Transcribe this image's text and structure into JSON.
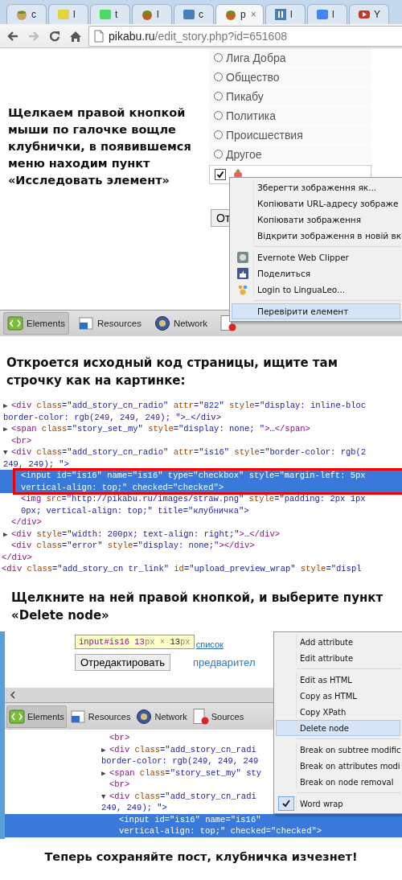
{
  "browser": {
    "tabs": [
      {
        "label": "c",
        "selected": false
      },
      {
        "label": "l",
        "selected": false
      },
      {
        "label": "t",
        "selected": false
      },
      {
        "label": "l",
        "selected": false
      },
      {
        "label": "c",
        "selected": false
      },
      {
        "label": "p",
        "selected": true,
        "close": "×"
      },
      {
        "label": "l",
        "selected": false
      },
      {
        "label": "l",
        "selected": false
      },
      {
        "label": "Y",
        "selected": false
      }
    ],
    "nav": [
      {
        "kind": "back",
        "disabled": false
      },
      {
        "kind": "forward",
        "disabled": true
      },
      {
        "kind": "reload",
        "disabled": false
      },
      {
        "kind": "home",
        "disabled": false
      }
    ],
    "url": {
      "host": "pikabu.ru",
      "path": "/edit_story.php?id=651608"
    }
  },
  "step1": {
    "caption": "Щелкаем правой кнопкой мыши по галочке вощле клубнички, в появившемся меню находим пункт «Исследовать элемент»",
    "radios": [
      {
        "label": "Лига Добра",
        "selected": false
      },
      {
        "label": "Общество",
        "selected": false
      },
      {
        "label": "Пикабу",
        "selected": false
      },
      {
        "label": "Политика",
        "selected": false
      },
      {
        "label": "Происшествия",
        "selected": false
      },
      {
        "label": "Другое",
        "selected": false
      }
    ],
    "checkbox": {
      "checked": true
    },
    "button": "От",
    "menu": [
      {
        "kind": "item",
        "label": "Зберегти зображення як...",
        "selected": false
      },
      {
        "kind": "item",
        "label": "Копіювати URL-адресу зображе",
        "selected": false
      },
      {
        "kind": "item",
        "label": "Копіювати зображення",
        "selected": false
      },
      {
        "kind": "item",
        "label": "Відкрити зображення в новій вк",
        "selected": false
      },
      {
        "kind": "separator"
      },
      {
        "kind": "plugin",
        "label": "Evernote Web Clipper",
        "selected": false
      },
      {
        "kind": "plugin",
        "label": "Поделиться",
        "selected": false
      },
      {
        "kind": "plugin",
        "label": "Login to LinguaLeo...",
        "selected": false
      },
      {
        "kind": "separator"
      },
      {
        "kind": "item",
        "label": "Перевірити елемент",
        "selected": true
      }
    ],
    "devtools_tabs": [
      {
        "label": "Elements",
        "selected": true
      },
      {
        "label": "Resources",
        "selected": false
      },
      {
        "label": "Network",
        "selected": false
      },
      {
        "selected": false
      }
    ]
  },
  "step2": {
    "caption": "Откроется исходный код страницы, ищите там строчку как на картинке:",
    "code": [
      {
        "children": [
          {
            "toggle": "▶",
            "lines": [
              "<div class=\"add_story_cn_radio\" attr=\"822\" style=\"display: inline-bloc",
              "border-color: rgb(249, 249, 249); \">…</div>"
            ],
            "selected": false
          },
          {
            "toggle": "▶",
            "lines": [
              "<span class=\"story_set_my\" style=\"display: none; \">…</span>"
            ],
            "selected": false
          },
          {
            "lines": [
              "<br>"
            ],
            "selected": false
          },
          {
            "toggle": "▼",
            "lines": [
              "<div class=\"add_story_cn_radio\" attr=\"is16\" style=\"border-color: rgb(2",
              "249, 249); \">"
            ],
            "selected": false,
            "closing": "</div>",
            "children": [
              {
                "lines": [
                  "<input id=\"is16\" name=\"is16\" type=\"checkbox\" style=\"margin-left: 5px",
                  "vertical-align: top;\" checked=\"checked\">"
                ],
                "selected": true
              },
              {
                "lines": [
                  "<img src=\"http://pikabu.ru/images/straw.png\" style=\"padding: 2px 1px",
                  "0px; vertical-align: top;\" title=\"клубничка\">"
                ],
                "selected": false
              }
            ]
          },
          {
            "toggle": "▶",
            "lines": [
              "<div style=\"width: 200px; text-align: right;\">…</div>"
            ],
            "selected": false
          },
          {
            "lines": [
              "<div class=\"error\" style=\"display: none;\"></div>"
            ],
            "selected": false
          }
        ],
        "closing": "</div>"
      },
      {
        "lines": [
          "<div class=\"add_story_cn tr_link\" id=\"upload_preview_wrap\" style=\"displ"
        ],
        "selected": false
      }
    ]
  },
  "step3": {
    "caption": "Щелкните на ней правой кнопкой, и выберите пункт «Delete node»",
    "tooltip": "input#is16 13px × 13px",
    "link": "список",
    "button": "Отредактировать",
    "preview_link": "предварител",
    "devtools_tabs": [
      {
        "label": "Elements",
        "selected": true
      },
      {
        "label": "Resources",
        "selected": false
      },
      {
        "label": "Network",
        "selected": false
      },
      {
        "label": "Sources",
        "selected": false
      }
    ],
    "code": [
      {
        "lines": [
          "<br>"
        ],
        "selected": false
      },
      {
        "toggle": "▶",
        "lines": [
          "<div class=\"add_story_cn_radi",
          "border-color: rgb(249, 249, 249"
        ],
        "selected": false
      },
      {
        "toggle": "▶",
        "lines": [
          "<span class=\"story_set_my\" sty"
        ],
        "selected": false
      },
      {
        "lines": [
          "<br>"
        ],
        "selected": false
      },
      {
        "toggle": "▼",
        "lines": [
          "<div class=\"add_story_cn_radi",
          "249, 249); \">"
        ],
        "selected": false,
        "children": [
          {
            "lines": [
              "<input id=\"is16\" name=\"is16\"",
              "vertical-align: top;\" checked=\"checked\">"
            ],
            "selected": true
          }
        ]
      }
    ],
    "menu": [
      {
        "kind": "item",
        "label": "Add attribute",
        "selected": false,
        "checked": false
      },
      {
        "kind": "item",
        "label": "Edit attribute",
        "selected": false,
        "checked": false
      },
      {
        "kind": "separator"
      },
      {
        "kind": "item",
        "label": "Edit as HTML",
        "selected": false,
        "checked": false
      },
      {
        "kind": "item",
        "label": "Copy as HTML",
        "selected": false,
        "checked": false
      },
      {
        "kind": "item",
        "label": "Copy XPath",
        "selected": false,
        "checked": false
      },
      {
        "kind": "item",
        "label": "Delete node",
        "selected": true,
        "checked": false
      },
      {
        "kind": "separator"
      },
      {
        "kind": "item",
        "label": "Break on subtree modific",
        "selected": false,
        "checked": false
      },
      {
        "kind": "item",
        "label": "Break on attributes modi",
        "selected": false,
        "checked": false
      },
      {
        "kind": "item",
        "label": "Break on node removal",
        "selected": false,
        "checked": false
      },
      {
        "kind": "separator"
      },
      {
        "kind": "item",
        "label": "Word wrap",
        "selected": false,
        "checked": true
      }
    ]
  },
  "final_caption": "Теперь сохраняйте пост, клубничка изчезнет!"
}
